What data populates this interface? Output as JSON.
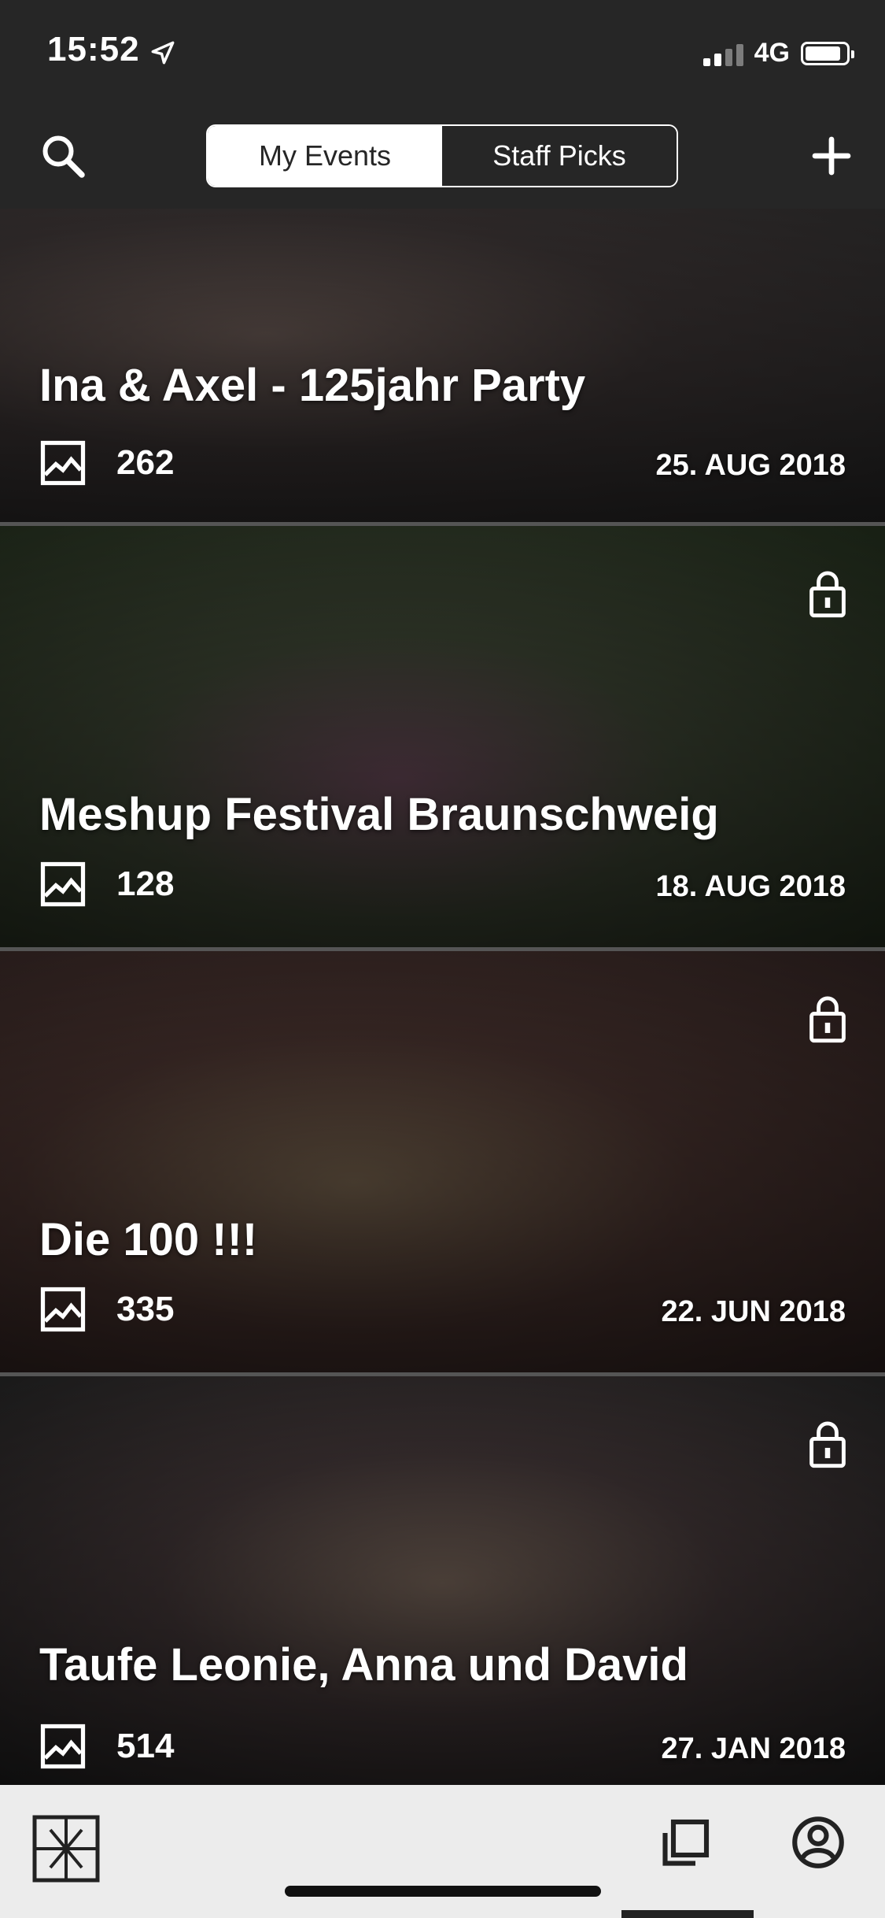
{
  "status": {
    "time": "15:52",
    "network": "4G"
  },
  "nav": {
    "segments": [
      "My Events",
      "Staff Picks"
    ],
    "active_segment": "My Events",
    "icons": {
      "left": "search-icon",
      "right": "plus-icon"
    }
  },
  "events": [
    {
      "title": "Ina & Axel -  125jahr Party",
      "count": "262",
      "date": "25. AUG 2018",
      "locked": false,
      "tint": "#4a4a4a"
    },
    {
      "title": "Meshup Festival Braunschweig",
      "count": "128",
      "date": "18. AUG 2018",
      "locked": true,
      "tint": "#2f3a2a"
    },
    {
      "title": "Die 100 !!!",
      "count": "335",
      "date": "22. JUN 2018",
      "locked": true,
      "tint": "#3a2b28"
    },
    {
      "title": "Taufe Leonie, Anna und David",
      "count": "514",
      "date": "27. JAN 2018",
      "locked": true,
      "tint": "#2e2a2a"
    }
  ],
  "tabbar": {
    "icons": [
      "logo-icon",
      "gallery-icon",
      "profile-icon"
    ]
  },
  "colors": {
    "dark": "#262626",
    "tabbar": "#ececec",
    "text": "#ffffff"
  }
}
